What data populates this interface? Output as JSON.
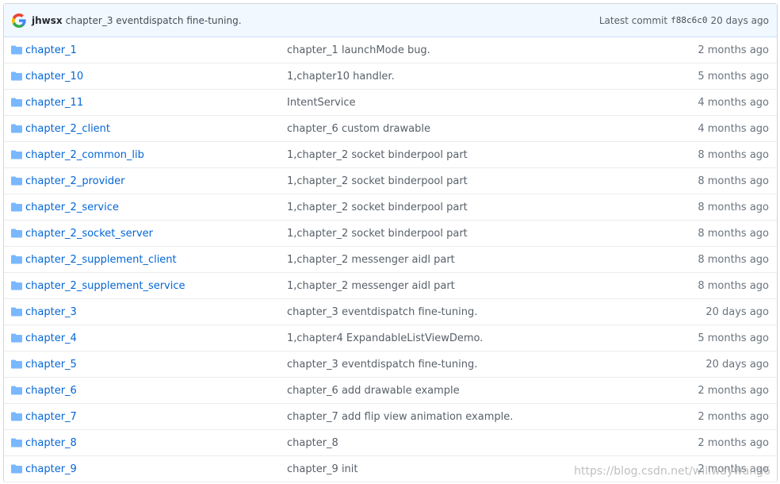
{
  "commit": {
    "author": "jhwsx",
    "message": "chapter_3 eventdispatch fine-tuning.",
    "latest_label": "Latest commit",
    "sha": "f88c6c0",
    "age": "20 days ago",
    "avatar_icon": "google-g-icon"
  },
  "files": [
    {
      "name": "chapter_1",
      "message": "chapter_1 launchMode bug.",
      "age": "2 months ago"
    },
    {
      "name": "chapter_10",
      "message": "1,chapter10 handler.",
      "age": "5 months ago"
    },
    {
      "name": "chapter_11",
      "message": "IntentService",
      "age": "4 months ago"
    },
    {
      "name": "chapter_2_client",
      "message": "chapter_6 custom drawable",
      "age": "4 months ago"
    },
    {
      "name": "chapter_2_common_lib",
      "message": "1,chapter_2 socket binderpool part",
      "age": "8 months ago"
    },
    {
      "name": "chapter_2_provider",
      "message": "1,chapter_2 socket binderpool part",
      "age": "8 months ago"
    },
    {
      "name": "chapter_2_service",
      "message": "1,chapter_2 socket binderpool part",
      "age": "8 months ago"
    },
    {
      "name": "chapter_2_socket_server",
      "message": "1,chapter_2 socket binderpool part",
      "age": "8 months ago"
    },
    {
      "name": "chapter_2_supplement_client",
      "message": "1,chapter_2 messenger aidl part",
      "age": "8 months ago"
    },
    {
      "name": "chapter_2_supplement_service",
      "message": "1,chapter_2 messenger aidl part",
      "age": "8 months ago"
    },
    {
      "name": "chapter_3",
      "message": "chapter_3 eventdispatch fine-tuning.",
      "age": "20 days ago"
    },
    {
      "name": "chapter_4",
      "message": "1,chapter4 ExpandableListViewDemo.",
      "age": "5 months ago"
    },
    {
      "name": "chapter_5",
      "message": "chapter_3 eventdispatch fine-tuning.",
      "age": "20 days ago"
    },
    {
      "name": "chapter_6",
      "message": "chapter_6 add drawable example",
      "age": "2 months ago"
    },
    {
      "name": "chapter_7",
      "message": "chapter_7 add flip view animation example.",
      "age": "2 months ago"
    },
    {
      "name": "chapter_8",
      "message": "chapter_8",
      "age": "2 months ago"
    },
    {
      "name": "chapter_9",
      "message": "chapter_9 init",
      "age": "2 months ago"
    }
  ],
  "folder_icon": "folder-icon",
  "watermark": "https://blog.csdn.net/willwaywang6",
  "colors": {
    "link": "#0366d6",
    "folder": "#79b8ff",
    "commit_bar_bg": "#f1f8ff"
  }
}
